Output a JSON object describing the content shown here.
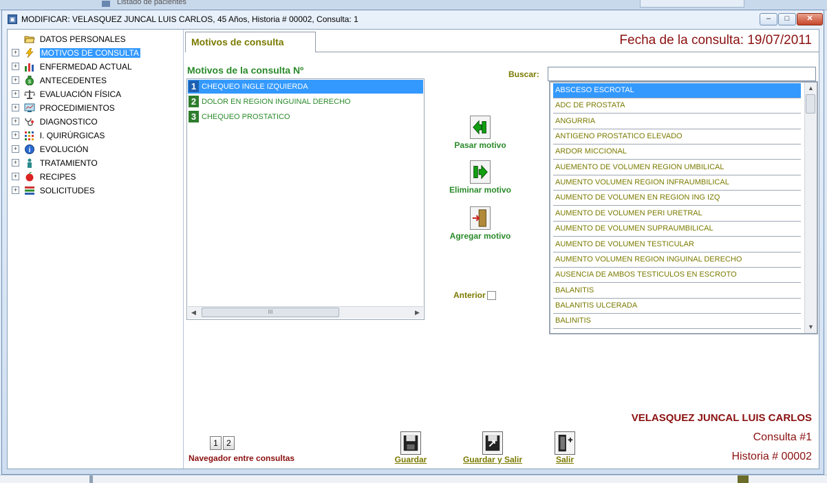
{
  "background": {
    "window_title": "Listado de pacientes"
  },
  "window": {
    "title": "MODIFICAR: VELASQUEZ JUNCAL LUIS CARLOS, 45 Años, Historia # 00002, Consulta: 1",
    "controls": {
      "minimize": "–",
      "maximize": "□",
      "close": "✕"
    }
  },
  "tree": {
    "items": [
      {
        "label": "DATOS PERSONALES",
        "icon": "folder-open-icon",
        "expandable": false,
        "selected": false
      },
      {
        "label": "MOTIVOS DE CONSULTA",
        "icon": "lightning-icon",
        "expandable": true,
        "selected": true
      },
      {
        "label": "ENFERMEDAD ACTUAL",
        "icon": "bar-chart-icon",
        "expandable": true,
        "selected": false
      },
      {
        "label": "ANTECEDENTES",
        "icon": "money-bag-icon",
        "expandable": true,
        "selected": false
      },
      {
        "label": "EVALUACIÓN FÍSICA",
        "icon": "scale-icon",
        "expandable": true,
        "selected": false
      },
      {
        "label": "PROCEDIMIENTOS",
        "icon": "monitor-icon",
        "expandable": true,
        "selected": false
      },
      {
        "label": "DIAGNOSTICO",
        "icon": "stethoscope-icon",
        "expandable": true,
        "selected": false
      },
      {
        "label": "I. QUIRÚRGICAS",
        "icon": "grid-dots-icon",
        "expandable": true,
        "selected": false
      },
      {
        "label": "EVOLUCIÓN",
        "icon": "info-icon",
        "expandable": true,
        "selected": false
      },
      {
        "label": "TRATAMIENTO",
        "icon": "person-icon",
        "expandable": true,
        "selected": false
      },
      {
        "label": "RECIPES",
        "icon": "apple-icon",
        "expandable": true,
        "selected": false
      },
      {
        "label": "SOLICITUDES",
        "icon": "list-icon",
        "expandable": true,
        "selected": false
      }
    ]
  },
  "tab": {
    "label": "Motivos de consulta"
  },
  "fecha": "Fecha de la consulta:  19/07/2011",
  "motivos": {
    "title": "Motivos de la consulta Nº",
    "items": [
      {
        "n": "1",
        "text": "CHEQUEO INGLE IZQUIERDA",
        "selected": true
      },
      {
        "n": "2",
        "text": "DOLOR EN REGION INGUINAL DERECHO",
        "selected": false
      },
      {
        "n": "3",
        "text": "CHEQUEO PROSTATICO",
        "selected": false
      }
    ],
    "scroll": {
      "left": "◀",
      "right": "▶",
      "thumb": "III"
    }
  },
  "actions": {
    "pasar": "Pasar motivo",
    "eliminar": "Eliminar motivo",
    "agregar": "Agregar motivo",
    "anterior": "Anterior"
  },
  "buscar": {
    "label": "Buscar:",
    "value": ""
  },
  "results": {
    "items": [
      "ABSCESO ESCROTAL",
      "ADC DE PROSTATA",
      "ANGURRIA",
      "ANTIGENO PROSTATICO ELEVADO",
      "ARDOR MICCIONAL",
      "AUEMENTO DE  VOLUMEN REGION UMBILICAL",
      "AUMENTO  VOLUMEN  REGION INFRAUMBILICAL",
      "AUMENTO DE VOLUMEN EN REGION ING IZQ",
      "AUMENTO DE VOLUMEN PERI URETRAL",
      "AUMENTO DE VOLUMEN SUPRAUMBILICAL",
      "AUMENTO DE VOLUMEN TESTICULAR",
      "AUMENTO VOLUMEN REGION INGUINAL DERECHO",
      "AUSENCIA DE AMBOS TESTICULOS EN ESCROTO",
      "BALANITIS",
      "BALANITIS ULCERADA",
      "BALINITIS"
    ],
    "selected_index": 0,
    "scroll": {
      "up": "▲",
      "down": "▼"
    }
  },
  "patient": {
    "name": "VELASQUEZ JUNCAL LUIS CARLOS",
    "consulta": "Consulta #1",
    "historia": "Historia # 00002"
  },
  "navigator": {
    "pages": [
      "1",
      "2"
    ],
    "label": "Navegador entre consultas"
  },
  "bottom_buttons": {
    "guardar": "Guardar",
    "guardar_salir": "Guardar y Salir",
    "salir": "Salir"
  },
  "colors": {
    "selection": "#3399ff",
    "green_text": "#2a8a2a",
    "olive_text": "#7a7a00",
    "maroon_text": "#8b1010"
  }
}
